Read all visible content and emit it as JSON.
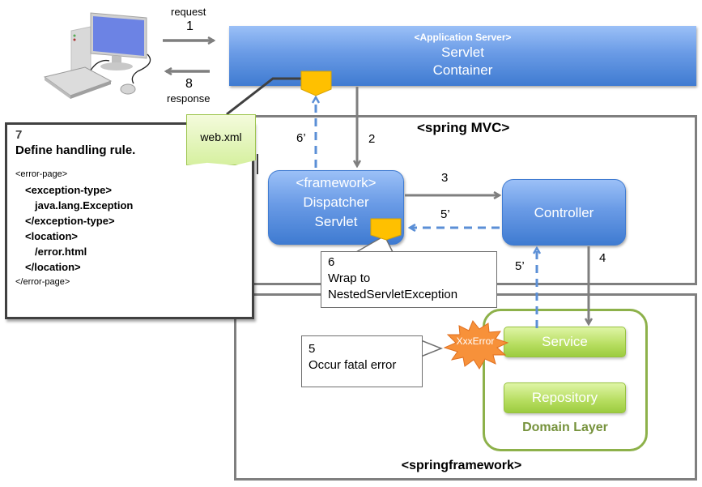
{
  "client": {
    "icon": "desktop-computer-icon"
  },
  "arrows": {
    "request_label": "request",
    "request_step": "1",
    "response_step": "8",
    "response_label": "response",
    "step2": "2",
    "step3": "3",
    "step4": "4",
    "step5p_controller": "5’",
    "step5p_service": "5’",
    "step6p": "6’"
  },
  "app_server": {
    "stereotype": "<Application Server>",
    "line1": "Servlet",
    "line2": "Container"
  },
  "spring_mvc": {
    "title": "<spring MVC>"
  },
  "springframework": {
    "title": "<springframework>"
  },
  "dispatcher": {
    "stereotype": "<framework>",
    "line1": "Dispatcher",
    "line2": "Servlet"
  },
  "controller": {
    "label": "Controller"
  },
  "domain_layer": {
    "title": "Domain Layer",
    "service": "Service",
    "repository": "Repository"
  },
  "error_burst": {
    "label": "XxxError"
  },
  "webxml_note": {
    "label": "web.xml"
  },
  "callout7": {
    "step": "7",
    "title": "Define handling rule.",
    "code": [
      {
        "text": "<error-page>",
        "bold": false,
        "indent": 0
      },
      {
        "text": "<exception-type>",
        "bold": true,
        "indent": 1
      },
      {
        "text": "java.lang.Exception",
        "bold": true,
        "indent": 2
      },
      {
        "text": "</exception-type>",
        "bold": true,
        "indent": 1
      },
      {
        "text": "<location>",
        "bold": true,
        "indent": 1
      },
      {
        "text": "/error.html",
        "bold": true,
        "indent": 2
      },
      {
        "text": "</location>",
        "bold": true,
        "indent": 1
      },
      {
        "text": "</error-page>",
        "bold": false,
        "indent": 0
      }
    ]
  },
  "callout6": {
    "step": "6",
    "line1": "Wrap to",
    "line2": "NestedServletException"
  },
  "callout5": {
    "step": "5",
    "line1": "Occur fatal error"
  },
  "colors": {
    "frame_gray": "#7f7f7f",
    "arrow_gray": "#7f7f7f",
    "dashed_blue": "#5b8fd6",
    "domain_green": "#8db14a",
    "domain_text": "#76923c",
    "burst_orange": "#f7913a",
    "marker_yellow": "#ffc000"
  }
}
